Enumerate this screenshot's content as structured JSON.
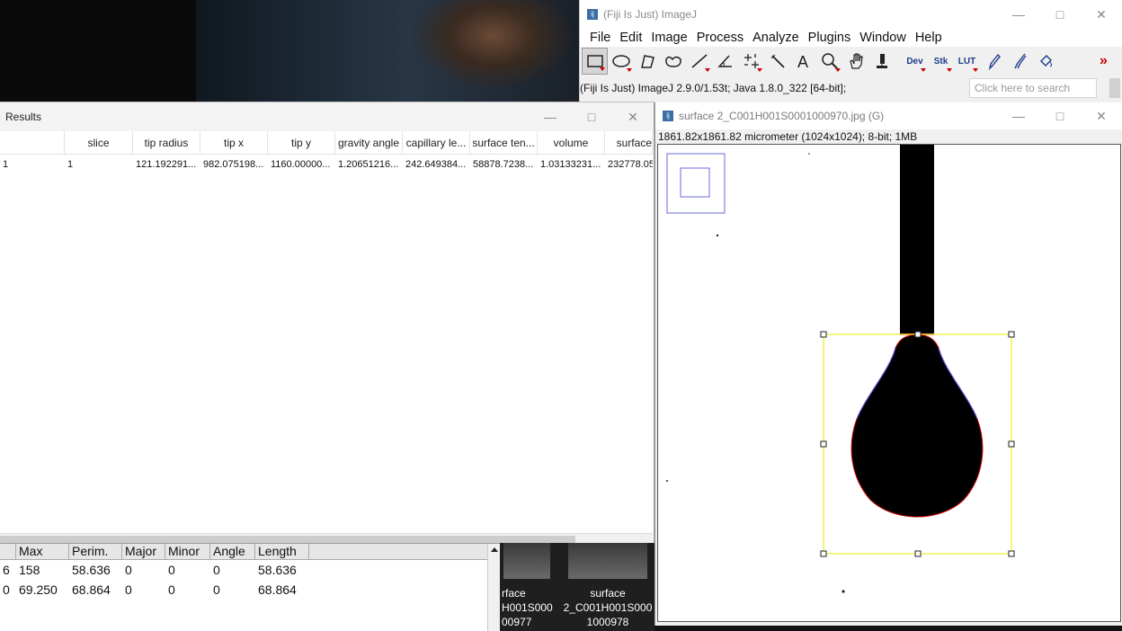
{
  "main_window": {
    "title": "(Fiji Is Just) ImageJ",
    "menus": [
      "File",
      "Edit",
      "Image",
      "Process",
      "Analyze",
      "Plugins",
      "Window",
      "Help"
    ],
    "tools": [
      {
        "name": "rectangle-tool-icon"
      },
      {
        "name": "oval-tool-icon"
      },
      {
        "name": "polygon-tool-icon"
      },
      {
        "name": "freehand-tool-icon"
      },
      {
        "name": "line-tool-icon"
      },
      {
        "name": "angle-tool-icon"
      },
      {
        "name": "point-tool-icon"
      },
      {
        "name": "wand-tool-icon"
      },
      {
        "name": "text-tool-icon"
      },
      {
        "name": "magnifier-tool-icon"
      },
      {
        "name": "hand-tool-icon"
      },
      {
        "name": "dropper-tool-icon"
      }
    ],
    "tool_labels": {
      "dev": "Dev",
      "stk": "Stk",
      "lut": "LUT"
    },
    "status": "(Fiji Is Just) ImageJ 2.9.0/1.53t; Java 1.8.0_322 [64-bit];",
    "search_placeholder": "Click here to search"
  },
  "results_window": {
    "title": "Results",
    "columns": [
      "",
      "slice",
      "tip radius",
      "tip x",
      "tip y",
      "gravity angle",
      "capillary le...",
      "surface ten...",
      "volume",
      "surface"
    ],
    "rows": [
      [
        "1",
        "1",
        "121.192291...",
        "982.075198...",
        "1160.00000...",
        "1.20651216...",
        "242.649384...",
        "58878.7238...",
        "1.03133231...",
        "232778.05"
      ]
    ]
  },
  "measurements": {
    "columns": [
      "",
      "Max",
      "Perim.",
      "Major",
      "Minor",
      "Angle",
      "Length"
    ],
    "rows": [
      [
        "6",
        "158",
        "58.636",
        "0",
        "0",
        "0",
        "58.636"
      ],
      [
        "0",
        "69.250",
        "68.864",
        "0",
        "0",
        "0",
        "68.864"
      ]
    ]
  },
  "thumbnails": [
    {
      "line1": "rface",
      "line2": "H001S000",
      "line3": "00977"
    },
    {
      "line1": "surface",
      "line2": "2_C001H001S000",
      "line3": "1000978"
    }
  ],
  "image_window": {
    "title": "surface 2_C001H001S0001000970.jpg (G)",
    "info": "1861.82x1861.82 micrometer (1024x1024); 8-bit; 1MB"
  },
  "colors": {
    "selection": "#e8e800",
    "contour_red": "#cc0000",
    "contour_blue": "#5555ff",
    "overview_box": "#6a6adf"
  }
}
